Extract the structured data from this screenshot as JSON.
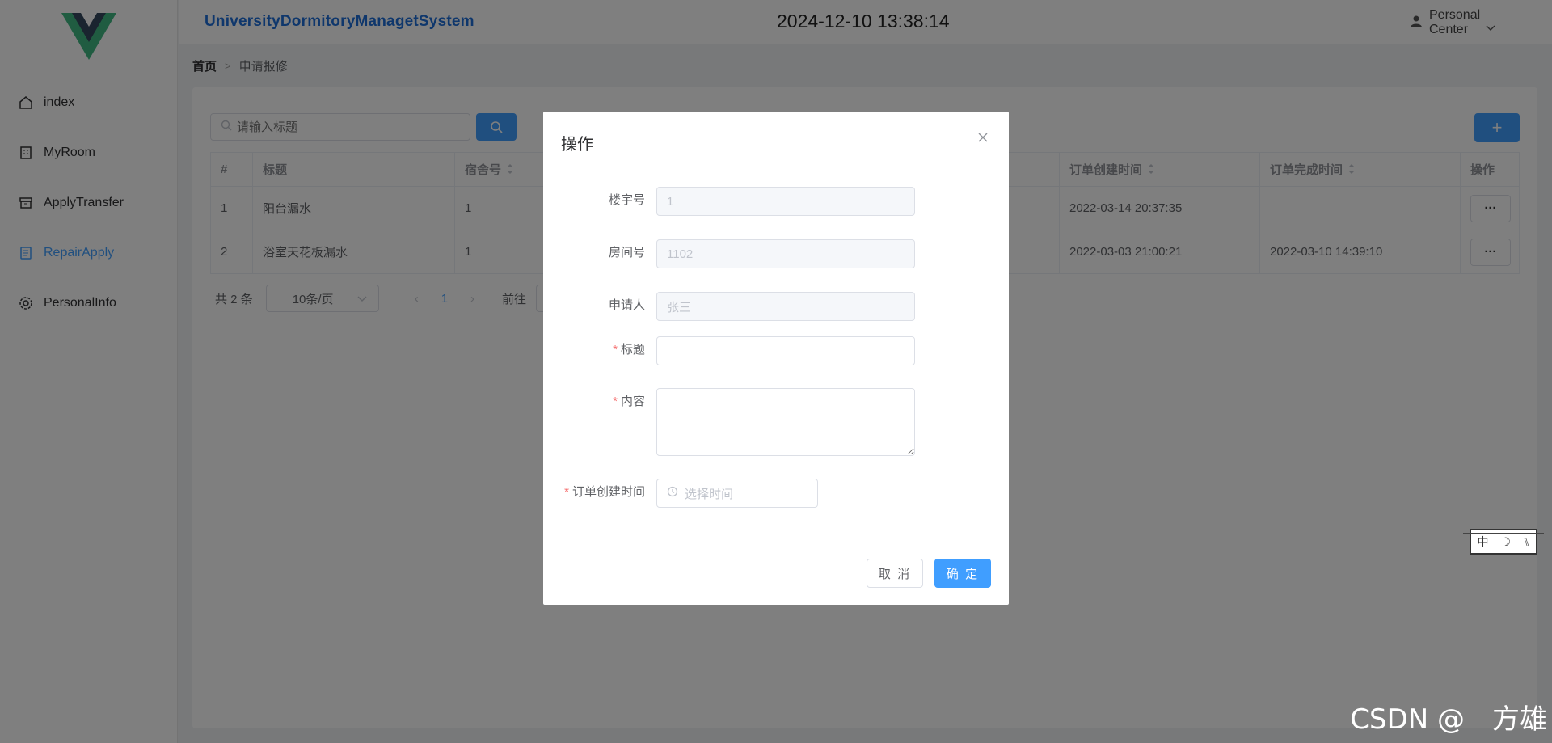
{
  "sidebar": {
    "items": [
      {
        "label": "index",
        "icon": "home-icon"
      },
      {
        "label": "MyRoom",
        "icon": "building-icon"
      },
      {
        "label": "ApplyTransfer",
        "icon": "box-icon"
      },
      {
        "label": "RepairApply",
        "icon": "notebook-icon",
        "active": true
      },
      {
        "label": "PersonalInfo",
        "icon": "gear-icon"
      }
    ]
  },
  "header": {
    "title": "UniversityDormitoryManagetSystem",
    "clock": "2024-12-10 13:38:14",
    "user_center": "Personal Center"
  },
  "breadcrumb": {
    "home": "首页",
    "current": "申请报修"
  },
  "search": {
    "placeholder": "请输入标题"
  },
  "table": {
    "headers": [
      "#",
      "标题",
      "宿舍号",
      "订单创建时间",
      "订单完成时间",
      "操作"
    ],
    "rows": [
      {
        "index": "1",
        "title": "阳台漏水",
        "room": "1",
        "created": "2022-03-14 20:37:35",
        "finished": ""
      },
      {
        "index": "2",
        "title": "浴室天花板漏水",
        "room": "1",
        "created": "2022-03-03 21:00:21",
        "finished": "2022-03-10 14:39:10"
      }
    ],
    "more_label": "···"
  },
  "pager": {
    "total": "共 2 条",
    "page_size": "10条/页",
    "current": "1",
    "goto": "前往"
  },
  "dialog": {
    "title": "操作",
    "fields": {
      "building": {
        "label": "楼宇号",
        "value": "1"
      },
      "room": {
        "label": "房间号",
        "value": "1102"
      },
      "applicant": {
        "label": "申请人",
        "value": "张三"
      },
      "title": {
        "label": "标题",
        "value": ""
      },
      "content": {
        "label": "内容",
        "value": ""
      },
      "created_time": {
        "label": "订单创建时间",
        "placeholder": "选择时间"
      }
    },
    "cancel_label": "取 消",
    "ok_label": "确 定"
  },
  "ime": {
    "chars": [
      "中",
      "☽",
      "⑊"
    ]
  },
  "watermark": "CSDN @　方雄",
  "colors": {
    "primary": "#409eff",
    "brand": "#1e6fd9",
    "required": "#f56c6c"
  }
}
